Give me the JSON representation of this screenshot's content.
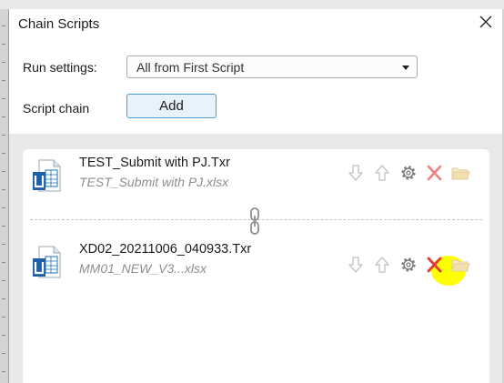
{
  "dialog": {
    "title": "Chain Scripts",
    "close_label": "✕"
  },
  "run_settings": {
    "label": "Run settings:",
    "selected": "All from First Script"
  },
  "script_chain": {
    "label": "Script chain",
    "add_label": "Add"
  },
  "scripts": [
    {
      "name": "TEST_Submit with PJ.Txr",
      "data_file": "TEST_Submit with PJ.xlsx"
    },
    {
      "name": "XD02_20211006_040933.Txr",
      "data_file": "MM01_NEW_V3...xlsx"
    }
  ],
  "colors": {
    "accent": "#4a9bd3",
    "delete": "#e53935",
    "highlight": "#ffff00",
    "disabled_icon": "#c8c8c8"
  },
  "icons": [
    "close-icon",
    "chevron-down-icon",
    "file-icon",
    "arrow-down-icon",
    "arrow-up-icon",
    "gear-icon",
    "delete-icon",
    "folder-icon",
    "chain-link-icon"
  ]
}
